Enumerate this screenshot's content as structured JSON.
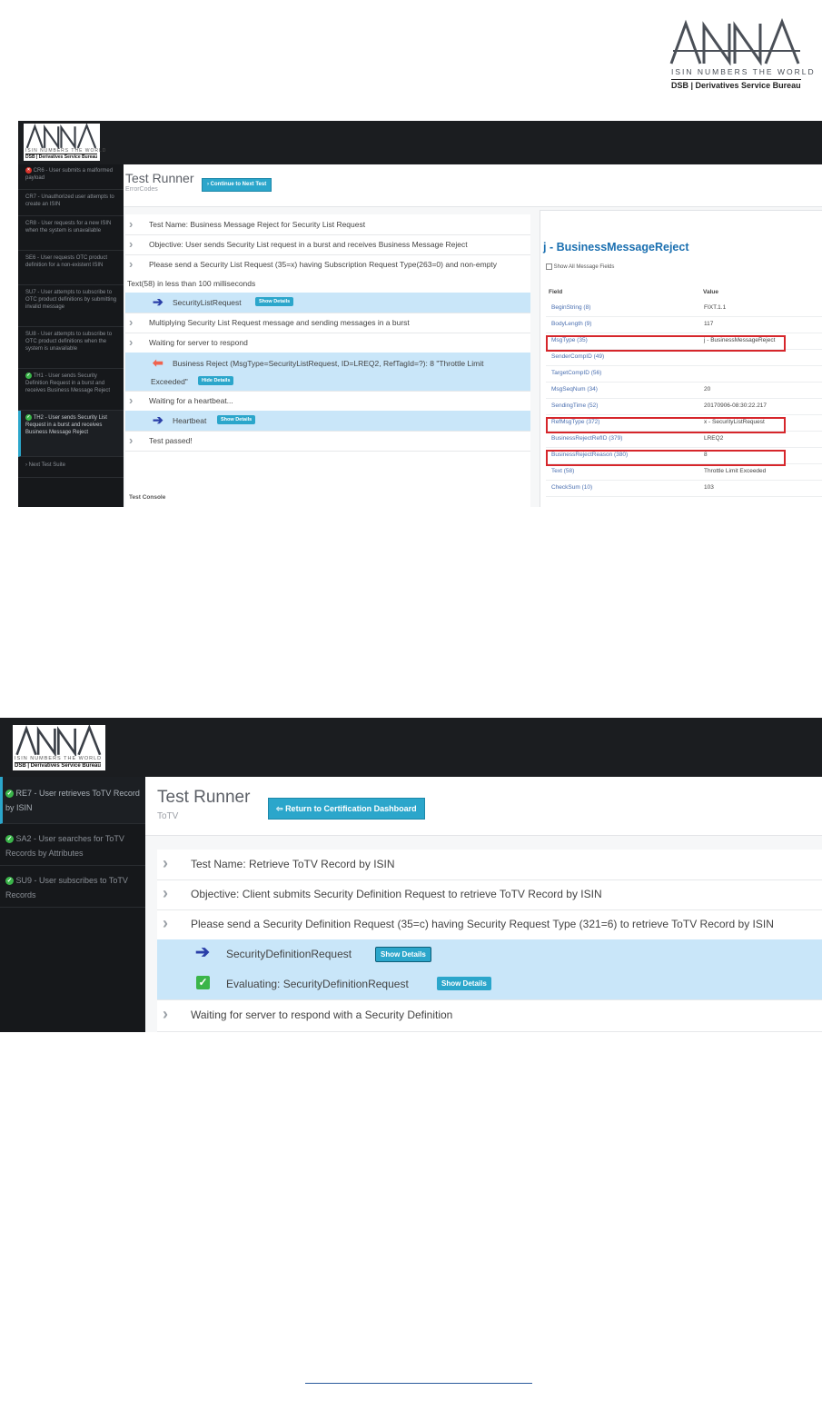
{
  "header_logo": {
    "letters": "ANNA",
    "tagline": "ISIN NUMBERS THE WORLD",
    "dsb": "DSB | Derivatives Service Bureau"
  },
  "shot1": {
    "logo": {
      "letters": "ANNA",
      "tagline": "ISIN NUMBERS THE WORLD",
      "dsb": "DSB | Derivatives Service Bureau"
    },
    "sidebar": [
      {
        "status": "error",
        "label": "CR6 - User submits a malformed payload"
      },
      {
        "status": "none",
        "label": "CR7 - Unauthorized user attempts to create an ISIN"
      },
      {
        "status": "none",
        "label": "CR8 - User requests for a new ISIN when the system is unavailable"
      },
      {
        "status": "none",
        "label": "SE6 - User requests OTC product definition for a non-existent ISIN"
      },
      {
        "status": "none",
        "label": "SU7 - User attempts to subscribe to OTC product definitions by submitting invalid message"
      },
      {
        "status": "none",
        "label": "SU8 - User attempts to subscribe to OTC product definitions when the system is unavailable"
      },
      {
        "status": "ok",
        "label": "TH1 - User sends Security Definition Request in a burst and receives Business Message Reject"
      },
      {
        "status": "ok",
        "label": "TH2 - User sends Security List Request in a burst and receives Business Message Reject"
      },
      {
        "status": "next",
        "label": "Next Test Suite"
      }
    ],
    "title": "Test Runner",
    "subtitle": "ErrorCodes",
    "continue_btn": "Continue to Next Test",
    "steps": {
      "name": "Test Name: Business Message Reject for Security List Request",
      "objective": "Objective: User sends Security List request in a burst and receives Business Message Reject",
      "instr_1": "Please send a Security List Request (35=x) having Subscription Request Type(263=0) and non-empty",
      "instr_2": "Text(58) in less than 100 milliseconds",
      "sent": "SecurityListRequest",
      "show_details": "Show Details",
      "multiply": "Multiplying Security List Request message and sending messages in a burst",
      "waiting": "Waiting for server to respond",
      "reject_1": "Business Reject (MsgType=SecurityListRequest, ID=LREQ2, RefTagId=?): 8 \"Throttle Limit",
      "reject_2": "Exceeded\"",
      "hide_details": "Hide Details",
      "heartbeat_wait": "Waiting for a heartbeat...",
      "heartbeat": "Heartbeat",
      "passed": "Test passed!",
      "console": "Test Console"
    },
    "panel": {
      "title": "j - BusinessMessageReject",
      "show_all": "Show All Message Fields",
      "col_field": "Field",
      "col_value": "Value",
      "rows": [
        {
          "field": "BeginString (8)",
          "value": "FIXT.1.1"
        },
        {
          "field": "BodyLength (9)",
          "value": "117"
        },
        {
          "field": "MsgType (35)",
          "value": "j - BusinessMessageReject"
        },
        {
          "field": "SenderCompID (49)",
          "value": ""
        },
        {
          "field": "TargetCompID (56)",
          "value": ""
        },
        {
          "field": "MsgSeqNum (34)",
          "value": "20"
        },
        {
          "field": "SendingTime (52)",
          "value": "20170906-08:30:22.217"
        },
        {
          "field": "RefMsgType (372)",
          "value": "x - SecurityListRequest"
        },
        {
          "field": "BusinessRejectRefID (379)",
          "value": "LREQ2"
        },
        {
          "field": "BusinessRejectReason (380)",
          "value": "8"
        },
        {
          "field": "Text (58)",
          "value": "Throttle Limit Exceeded"
        },
        {
          "field": "CheckSum (10)",
          "value": "103"
        }
      ]
    }
  },
  "shot2": {
    "logo": {
      "letters": "ANNA",
      "tagline": "ISIN NUMBERS THE WORLD",
      "dsb": "DSB | Derivatives Service Bureau"
    },
    "sidebar": [
      {
        "status": "ok",
        "label": "RE7 - User retrieves ToTV Record by ISIN"
      },
      {
        "status": "ok",
        "label": "SA2 - User searches for ToTV Records by Attributes"
      },
      {
        "status": "ok",
        "label": "SU9 - User subscribes to ToTV Records"
      }
    ],
    "title": "Test Runner",
    "subtitle": "ToTV",
    "return_btn": "Return to Certification Dashboard",
    "steps": {
      "name": "Test Name: Retrieve ToTV Record by ISIN",
      "objective": "Objective: Client submits Security Definition Request to retrieve ToTV Record by ISIN",
      "instr": "Please send a Security Definition Request (35=c) having Security Request Type (321=6) to retrieve ToTV Record by ISIN",
      "sent": "SecurityDefinitionRequest",
      "show_details": "Show Details",
      "evaluating": "Evaluating: SecurityDefinitionRequest",
      "show_details_2": "Show Details",
      "waiting": "Waiting for server to respond with a Security Definition"
    }
  }
}
